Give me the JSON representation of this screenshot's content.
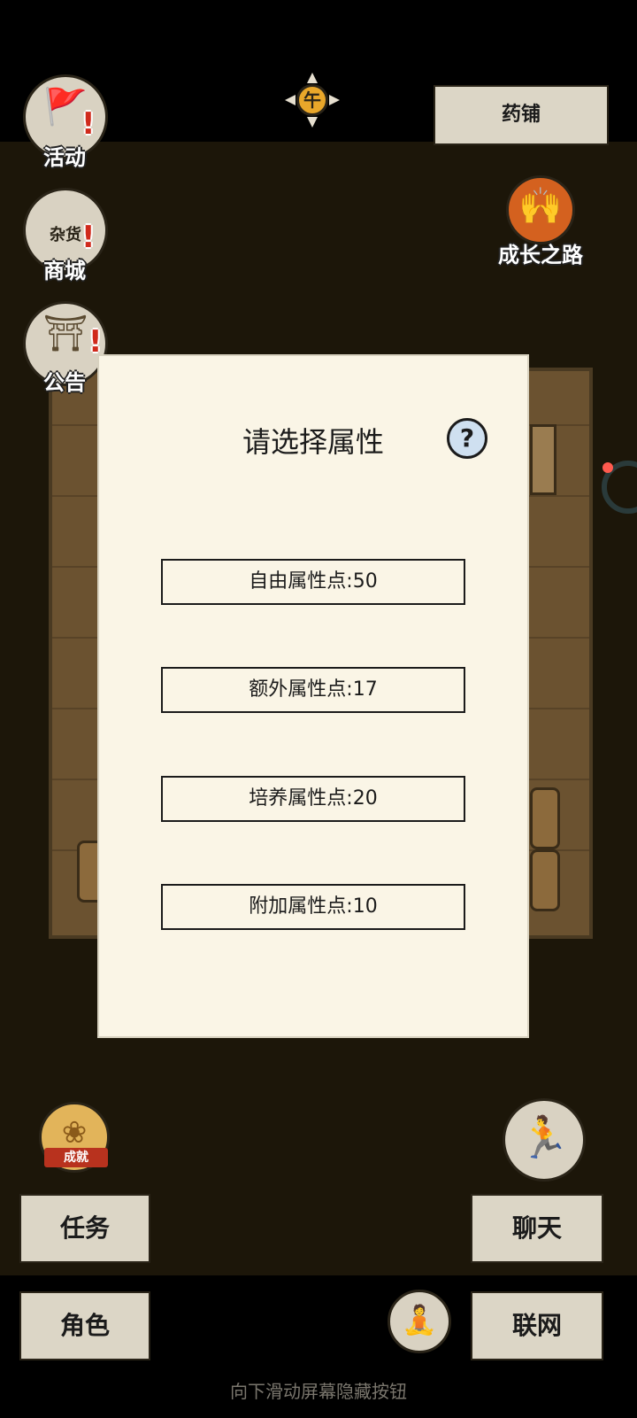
{
  "top": {
    "time_glyph": "午",
    "pharmacy_label": "药铺",
    "growth_label": "成长之路"
  },
  "left_menu": [
    {
      "label": "活动",
      "icon": "activity-flag-icon"
    },
    {
      "label": "商城",
      "icon": "shop-stall-icon",
      "sign": "杂货"
    },
    {
      "label": "公告",
      "icon": "notice-gate-icon"
    }
  ],
  "dialog": {
    "title": "请选择属性",
    "help_glyph": "?",
    "options": [
      {
        "label": "自由属性点:50"
      },
      {
        "label": "额外属性点:17"
      },
      {
        "label": "培养属性点:20"
      },
      {
        "label": "附加属性点:10"
      }
    ]
  },
  "bottom": {
    "achievement_badge": "成就",
    "task_label": "任务",
    "role_label": "角色",
    "chat_label": "聊天",
    "network_label": "联网",
    "hint": "向下滑动屏幕隐藏按钮"
  },
  "colors": {
    "parchment": "#faf5e6",
    "button_bg": "#dcd6c6",
    "scene_bg": "#1c1609",
    "alert_red": "#d02a1c",
    "sun_gold": "#e9a72a"
  }
}
